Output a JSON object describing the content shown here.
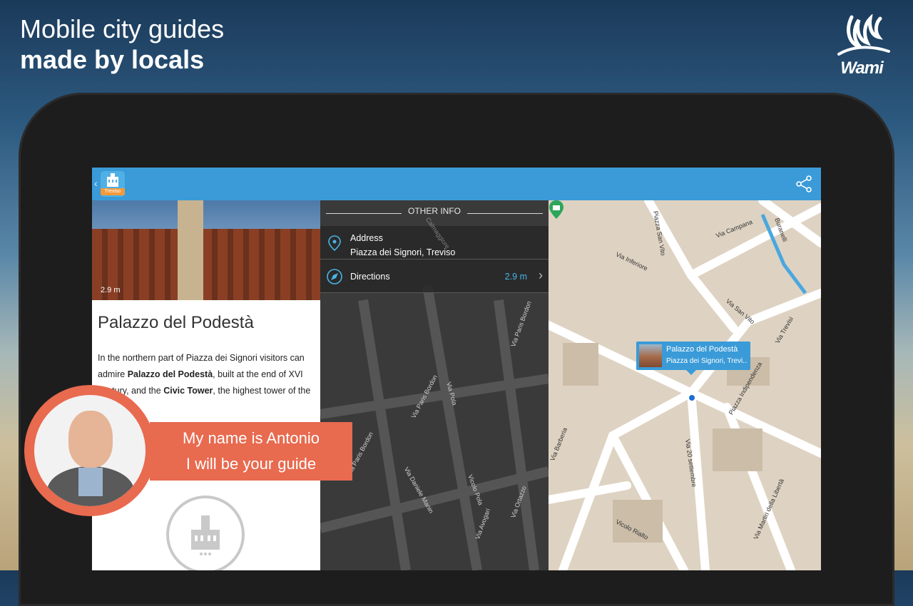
{
  "promo": {
    "line1": "Mobile city guides",
    "line2": "made by locals",
    "brand": "Wami"
  },
  "appbar": {
    "back_glyph": "‹",
    "city_tag": "Treviso",
    "share_icon": "share-icon"
  },
  "poi": {
    "distance": "2.9 m",
    "title": "Palazzo del Podestà",
    "desc_part1": "In the northern part of Piazza dei Signori visitors can admire ",
    "desc_bold1": "Palazzo del Podestà",
    "desc_part2": ", built at the end of XVI century, and the ",
    "desc_bold2": "Civic Tower",
    "desc_part3": ", the highest tower of the"
  },
  "info": {
    "section_title": "OTHER INFO",
    "address_label": "Address",
    "address_value": "Piazza dei Signori, Treviso",
    "directions_label": "Directions",
    "directions_value": "2.9 m"
  },
  "map": {
    "streets": [
      "Piazza San Vito",
      "Via Campana",
      "Buranelli",
      "Via Inferiore",
      "Via San Vito",
      "Via Trevisi",
      "Piazza Indipendenza",
      "Via Barberia",
      "Via 20 settembre",
      "Vicolo Rialto",
      "Via Martiri della Libertà"
    ],
    "dark_streets": [
      "Calmaggiore",
      "Via Pola",
      "Via Paris Bordon",
      "Via Paris Bordon",
      "Via Paris Bordon",
      "Via Daniele Manin",
      "Vicolo Pola",
      "Via Ortazzo",
      "Via Avogari"
    ],
    "callout_title": "Palazzo del Podestà",
    "callout_sub": "Piazza dei Signori, Trevi..."
  },
  "guide": {
    "line1": "My name is Antonio",
    "line2": "I will be your guide"
  }
}
